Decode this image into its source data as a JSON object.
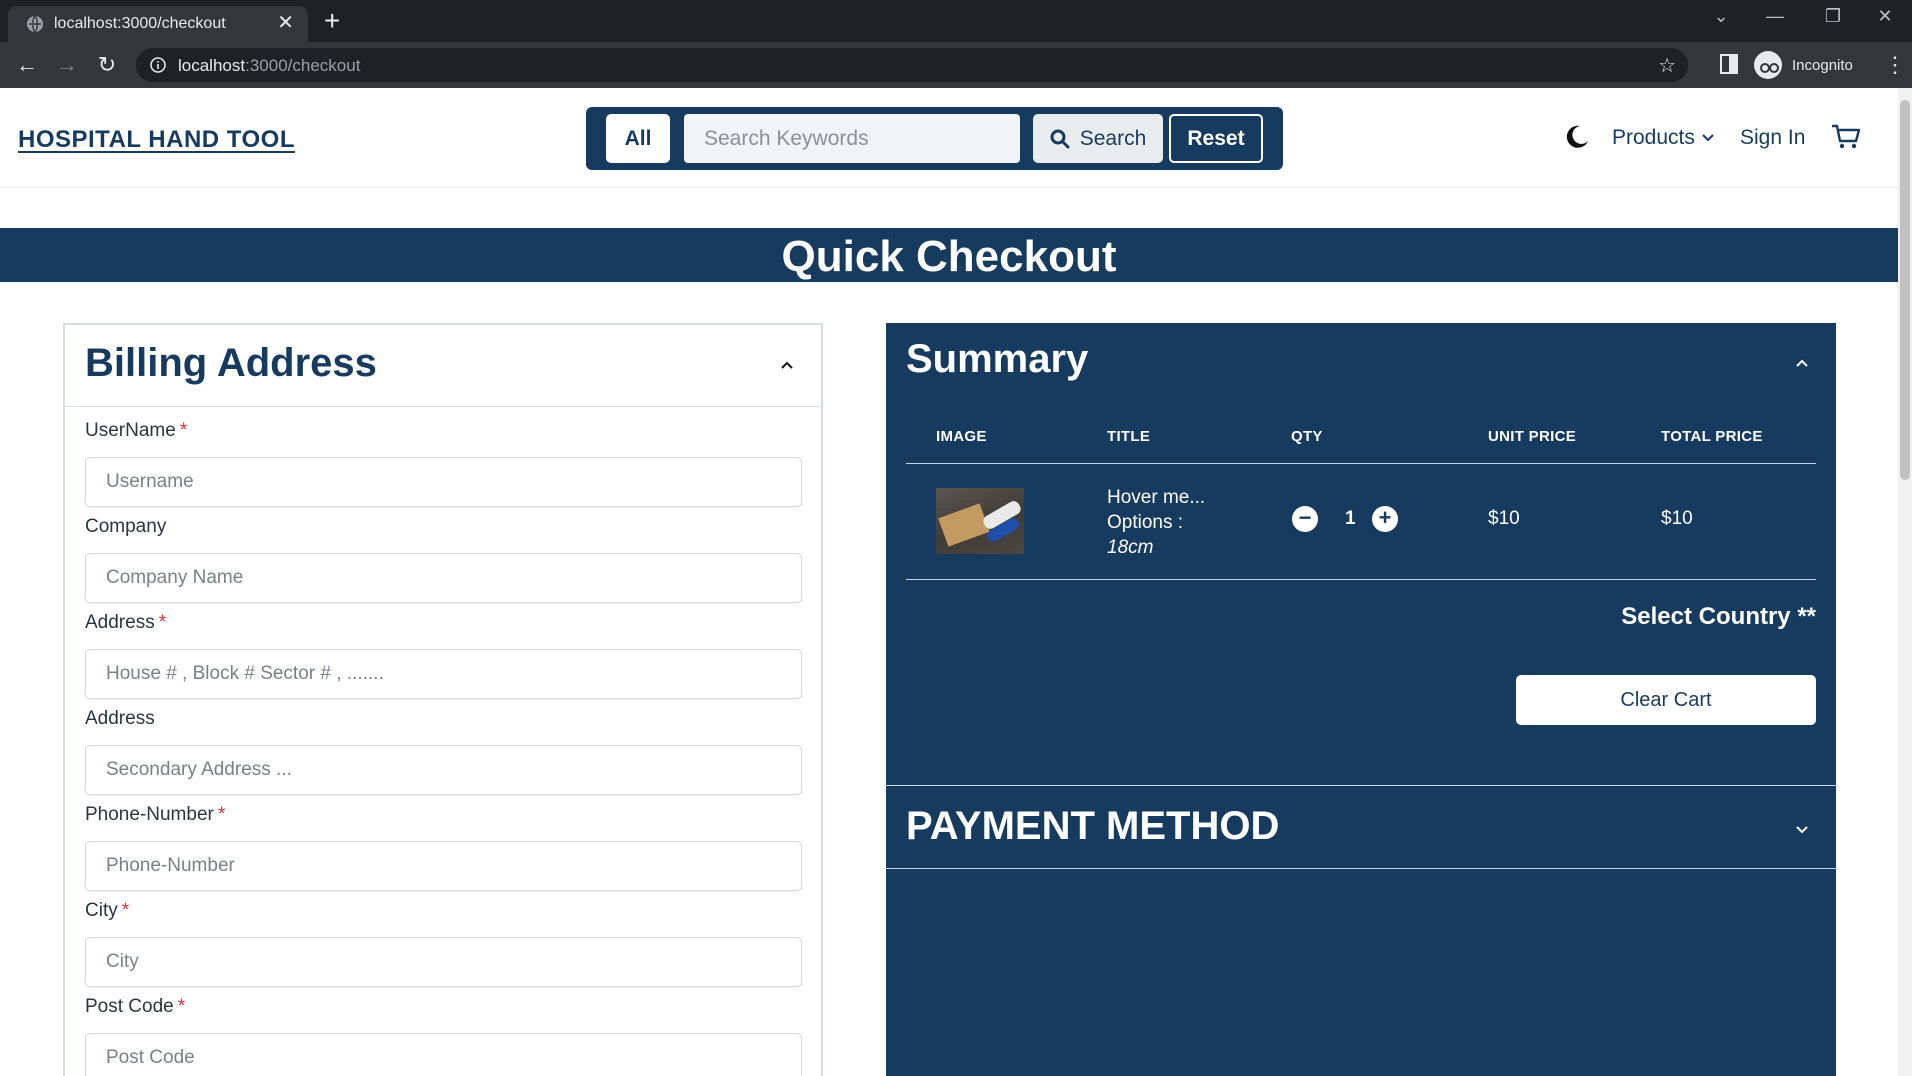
{
  "browser": {
    "tab_title": "localhost:3000/checkout",
    "new_tab": "+",
    "close_tab": "✕",
    "url_host": "localhost",
    "url_path": ":3000/checkout",
    "profile_label": "Incognito"
  },
  "header": {
    "brand": "HOSPITAL HAND TOOL",
    "category_button": "All",
    "search_placeholder": "Search Keywords",
    "search_button": "Search",
    "reset_button": "Reset",
    "nav_products": "Products",
    "nav_signin": "Sign In",
    "brand_color": "#173b5f"
  },
  "page": {
    "title": "Quick Checkout"
  },
  "billing": {
    "title": "Billing Address",
    "fields": [
      {
        "label": "UserName",
        "required": "*",
        "placeholder": "Username"
      },
      {
        "label": "Company",
        "required": "",
        "placeholder": "Company Name"
      },
      {
        "label": "Address",
        "required": "*",
        "placeholder": "House # , Block # Sector # , ......."
      },
      {
        "label": "Address",
        "required": "",
        "placeholder": "Secondary Address ..."
      },
      {
        "label": "Phone-Number",
        "required": "*",
        "placeholder": "Phone-Number"
      },
      {
        "label": "City",
        "required": "*",
        "placeholder": "City"
      },
      {
        "label": "Post Code",
        "required": "*",
        "placeholder": "Post Code"
      }
    ]
  },
  "summary": {
    "title": "Summary",
    "columns": [
      "IMAGE",
      "TITLE",
      "QTY",
      "UNIT PRICE",
      "TOTAL PRICE"
    ],
    "items": [
      {
        "title": "Hover me...",
        "options_label": "Options :",
        "option_value": "18cm",
        "qty": "1",
        "unit_price": "$10",
        "total_price": "$10"
      }
    ],
    "select_country": "Select Country **",
    "clear_cart": "Clear Cart"
  },
  "payment": {
    "title": "PAYMENT METHOD"
  }
}
